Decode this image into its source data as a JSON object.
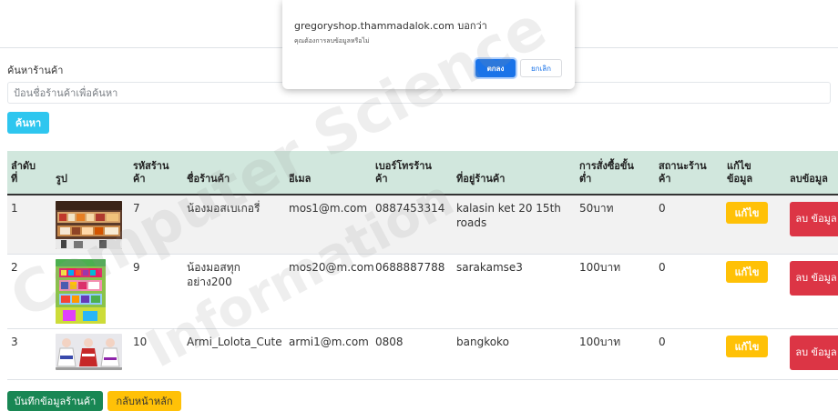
{
  "search": {
    "label": "ค้นหาร้านค้า",
    "placeholder": "ป้อนชื่อร้านค้าเพื่อค้นหา",
    "button_label": "ค้นหา"
  },
  "table": {
    "headers": {
      "no": [
        "ลำดับ",
        "ที่"
      ],
      "image": "รูป",
      "code": [
        "รหัสร้าน",
        "ค้า"
      ],
      "name": "ชื่อร้านค้า",
      "email": "อีเมล",
      "phone": [
        "เบอร์โทรร้าน",
        "ค้า"
      ],
      "address": "ที่อยู่ร้านค้า",
      "min_order": [
        "การสั่งซื้อขั้น",
        "ต่ำ"
      ],
      "status": [
        "สถานะร้าน",
        "ค้า"
      ],
      "edit": [
        "แก้ไข",
        "ข้อมูล"
      ],
      "delete": "ลบข้อมูล"
    },
    "rows": [
      {
        "no": "1",
        "code": "7",
        "name": "น้องมอสเบเกอรี่",
        "email": "mos1@m.com",
        "phone": "0887453314",
        "address": "kalasin ket 20 15th roads",
        "min_order": "50บาท",
        "status": "0",
        "edit_label": "แก้ไข",
        "delete_label": "ลบ ข้อมูล"
      },
      {
        "no": "2",
        "code": "9",
        "name": "น้องมอสทุก อย่าง200",
        "email": "mos20@m.com",
        "phone": "0688887788",
        "address": "sarakamse3",
        "min_order": "100บาท",
        "status": "0",
        "edit_label": "แก้ไข",
        "delete_label": "ลบ ข้อมูล"
      },
      {
        "no": "3",
        "code": "10",
        "name": "Armi_Lolota_Cute",
        "email": "armi1@m.com",
        "phone": "0808",
        "address": "bangkoko",
        "min_order": "100บาท",
        "status": "0",
        "edit_label": "แก้ไข",
        "delete_label": "ลบ ข้อมูล"
      }
    ]
  },
  "actions": {
    "save_label": "บันทึกข้อมูลร้านค้า",
    "home_label": "กลับหน้าหลัก"
  },
  "dialog": {
    "title": "gregoryshop.thammadalok.com บอกว่า",
    "message": "คุณต้องการลบข้อมูลหรือไม่",
    "ok_label": "ตกลง",
    "cancel_label": "ยกเลิก"
  },
  "watermark": {
    "line1": "Computer Science",
    "line2": "Information"
  },
  "colors": {
    "header_bg": "#d1e7dd",
    "search_button": "#2ec6ef",
    "edit_button": "#ffc107",
    "delete_button": "#dc3545",
    "save_button": "#198754",
    "dialog_ok": "#1a73e8"
  }
}
